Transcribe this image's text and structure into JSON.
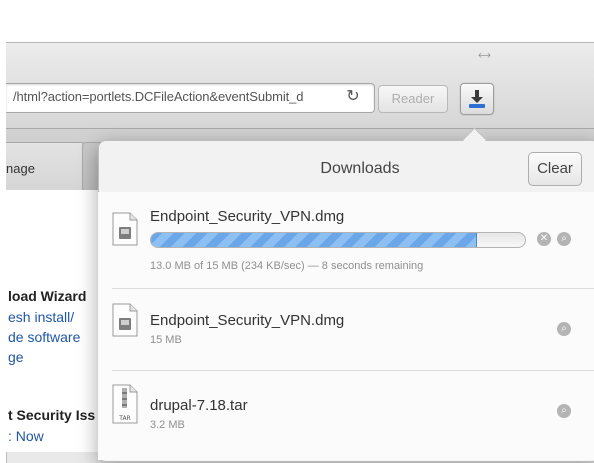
{
  "browser": {
    "address_url": "/html?action=portlets.DCFileAction&eventSubmit_d",
    "reader_label": "Reader",
    "tab_label": "nage"
  },
  "page": {
    "lines": [
      {
        "text": "load Wizard",
        "kind": "heading"
      },
      {
        "text": "esh install/",
        "kind": "link"
      },
      {
        "text": "de software",
        "kind": "link"
      },
      {
        "text": "ge",
        "kind": "link"
      },
      {
        "text": "t Security Iss",
        "kind": "heading"
      },
      {
        "text": ": Now",
        "kind": "link"
      }
    ]
  },
  "downloads": {
    "title": "Downloads",
    "clear_label": "Clear",
    "items": [
      {
        "name": "Endpoint_Security_VPN.dmg",
        "status": "13.0 MB of 15 MB (234 KB/sec) — 8 seconds remaining",
        "progress": 0.87,
        "in_progress": true,
        "icon": "dmg-file-icon"
      },
      {
        "name": "Endpoint_Security_VPN.dmg",
        "status": "15 MB",
        "in_progress": false,
        "icon": "dmg-file-icon"
      },
      {
        "name": "drupal-7.18.tar",
        "status": "3.2 MB",
        "in_progress": false,
        "icon": "tar-file-icon",
        "icon_label": "TAR"
      }
    ]
  },
  "colors": {
    "progress": "#6aa6e8",
    "download_button_accent": "#2d6fd1"
  }
}
